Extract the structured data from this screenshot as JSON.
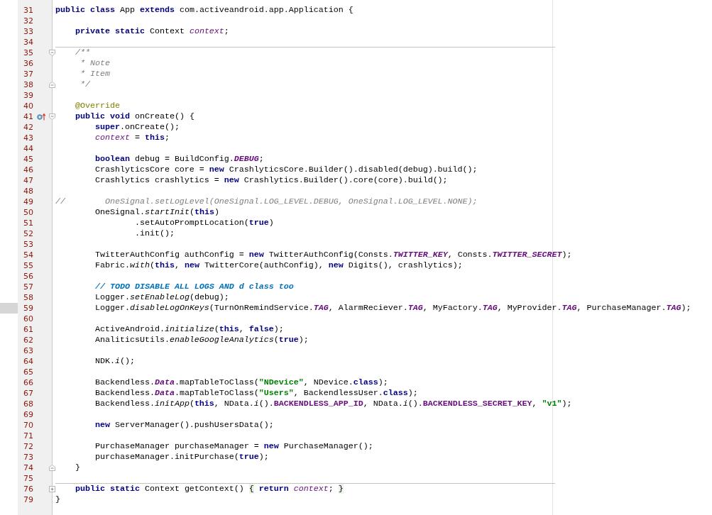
{
  "editor": {
    "lines": [
      {
        "number": "31",
        "current": false,
        "spans": [
          {
            "kind": "keyword",
            "text": "public class"
          },
          {
            "kind": "plain",
            "text": " App "
          },
          {
            "kind": "keyword",
            "text": "extends"
          },
          {
            "kind": "plain",
            "text": " com.activeandroid.app.Application {"
          }
        ]
      },
      {
        "number": "32",
        "current": false
      },
      {
        "number": "33",
        "current": false,
        "spans": [
          {
            "kind": "keyword",
            "text": "    private static"
          },
          {
            "kind": "plain",
            "text": " Context "
          },
          {
            "kind": "field",
            "text": "context"
          },
          {
            "kind": "plain",
            "text": ";"
          }
        ]
      },
      {
        "number": "34",
        "current": false
      },
      {
        "number": "35",
        "current": false,
        "separator": true,
        "fold": {
          "kind": "start"
        },
        "spans": [
          {
            "kind": "doc",
            "text": "    /**"
          }
        ]
      },
      {
        "number": "36",
        "current": false,
        "spans": [
          {
            "kind": "doc",
            "text": "     * Note"
          }
        ]
      },
      {
        "number": "37",
        "current": false,
        "spans": [
          {
            "kind": "doc",
            "text": "     * Item"
          }
        ]
      },
      {
        "number": "38",
        "current": false,
        "fold": {
          "kind": "end"
        },
        "spans": [
          {
            "kind": "doc",
            "text": "     */"
          }
        ]
      },
      {
        "number": "39",
        "current": false
      },
      {
        "number": "40",
        "current": false,
        "spans": [
          {
            "kind": "annotation",
            "text": "    @Override"
          }
        ]
      },
      {
        "number": "41",
        "current": false,
        "gutter_icon": {
          "kind": "override"
        },
        "fold": {
          "kind": "start"
        },
        "spans": [
          {
            "kind": "keyword",
            "text": "    public void"
          },
          {
            "kind": "plain",
            "text": " onCreate() {"
          }
        ]
      },
      {
        "number": "42",
        "current": false,
        "spans": [
          {
            "kind": "keyword",
            "text": "        super"
          },
          {
            "kind": "plain",
            "text": ".onCreate();"
          }
        ]
      },
      {
        "number": "43",
        "current": false,
        "spans": [
          {
            "kind": "field",
            "text": "        context"
          },
          {
            "kind": "plain",
            "text": " = "
          },
          {
            "kind": "keyword",
            "text": "this"
          },
          {
            "kind": "plain",
            "text": ";"
          }
        ]
      },
      {
        "number": "44",
        "current": false
      },
      {
        "number": "45",
        "current": false,
        "spans": [
          {
            "kind": "keyword",
            "text": "        boolean"
          },
          {
            "kind": "plain",
            "text": " debug = BuildConfig."
          },
          {
            "kind": "static-field",
            "text": "DEBUG"
          },
          {
            "kind": "plain",
            "text": ";"
          }
        ]
      },
      {
        "number": "46",
        "current": false,
        "spans": [
          {
            "kind": "plain",
            "text": "        CrashlyticsCore core = "
          },
          {
            "kind": "keyword",
            "text": "new"
          },
          {
            "kind": "plain",
            "text": " CrashlyticsCore.Builder().disabled(debug).build();"
          }
        ]
      },
      {
        "number": "47",
        "current": false,
        "spans": [
          {
            "kind": "plain",
            "text": "        Crashlytics crashlytics = "
          },
          {
            "kind": "keyword",
            "text": "new"
          },
          {
            "kind": "plain",
            "text": " Crashlytics.Builder().core(core).build();"
          }
        ]
      },
      {
        "number": "48",
        "current": false
      },
      {
        "number": "49",
        "current": false,
        "spans": [
          {
            "kind": "comment",
            "text": "//        OneSignal.setLogLevel(OneSignal.LOG_LEVEL.DEBUG, OneSignal.LOG_LEVEL.NONE);"
          }
        ]
      },
      {
        "number": "50",
        "current": false,
        "spans": [
          {
            "kind": "plain",
            "text": "        OneSignal."
          },
          {
            "kind": "static-method",
            "text": "startInit"
          },
          {
            "kind": "plain",
            "text": "("
          },
          {
            "kind": "keyword",
            "text": "this"
          },
          {
            "kind": "plain",
            "text": ")"
          }
        ]
      },
      {
        "number": "51",
        "current": false,
        "spans": [
          {
            "kind": "plain",
            "text": "                .setAutoPromptLocation("
          },
          {
            "kind": "keyword",
            "text": "true"
          },
          {
            "kind": "plain",
            "text": ")"
          }
        ]
      },
      {
        "number": "52",
        "current": false,
        "spans": [
          {
            "kind": "plain",
            "text": "                .init();"
          }
        ]
      },
      {
        "number": "53",
        "current": false
      },
      {
        "number": "54",
        "current": false,
        "spans": [
          {
            "kind": "plain",
            "text": "        TwitterAuthConfig authConfig = "
          },
          {
            "kind": "keyword",
            "text": "new"
          },
          {
            "kind": "plain",
            "text": " TwitterAuthConfig(Consts."
          },
          {
            "kind": "static-field",
            "text": "TWITTER_KEY"
          },
          {
            "kind": "plain",
            "text": ", Consts."
          },
          {
            "kind": "static-field",
            "text": "TWITTER_SECRET"
          },
          {
            "kind": "plain",
            "text": ");"
          }
        ]
      },
      {
        "number": "55",
        "current": false,
        "spans": [
          {
            "kind": "plain",
            "text": "        Fabric."
          },
          {
            "kind": "static-method",
            "text": "with"
          },
          {
            "kind": "plain",
            "text": "("
          },
          {
            "kind": "keyword",
            "text": "this"
          },
          {
            "kind": "plain",
            "text": ", "
          },
          {
            "kind": "keyword",
            "text": "new"
          },
          {
            "kind": "plain",
            "text": " TwitterCore(authConfig), "
          },
          {
            "kind": "keyword",
            "text": "new"
          },
          {
            "kind": "plain",
            "text": " Digits(), crashlytics);"
          }
        ]
      },
      {
        "number": "56",
        "current": false
      },
      {
        "number": "57",
        "current": false,
        "spans": [
          {
            "kind": "todo",
            "text": "        // TODO DISABLE ALL LOGS AND d class too"
          }
        ]
      },
      {
        "number": "58",
        "current": false,
        "spans": [
          {
            "kind": "plain",
            "text": "        Logger."
          },
          {
            "kind": "static-method",
            "text": "setEnableLog"
          },
          {
            "kind": "plain",
            "text": "(debug);"
          }
        ]
      },
      {
        "number": "59",
        "current": true,
        "spans": [
          {
            "kind": "plain",
            "text": "        Logger."
          },
          {
            "kind": "static-method",
            "text": "disableLogOnKeys"
          },
          {
            "kind": "plain",
            "text": "(TurnOnRemindService."
          },
          {
            "kind": "static-field",
            "text": "TAG"
          },
          {
            "kind": "plain",
            "text": ", AlarmReciever."
          },
          {
            "kind": "static-field",
            "text": "TAG"
          },
          {
            "kind": "plain",
            "text": ", MyFactory."
          },
          {
            "kind": "static-field",
            "text": "TAG"
          },
          {
            "kind": "plain",
            "text": ", MyProvider."
          },
          {
            "kind": "static-field",
            "text": "TAG"
          },
          {
            "kind": "plain",
            "text": ", PurchaseManager."
          },
          {
            "kind": "static-field",
            "text": "TAG"
          },
          {
            "kind": "plain",
            "text": ");"
          }
        ]
      },
      {
        "number": "60",
        "current": false
      },
      {
        "number": "61",
        "current": false,
        "spans": [
          {
            "kind": "plain",
            "text": "        ActiveAndroid."
          },
          {
            "kind": "static-method",
            "text": "initialize"
          },
          {
            "kind": "plain",
            "text": "("
          },
          {
            "kind": "keyword",
            "text": "this"
          },
          {
            "kind": "plain",
            "text": ", "
          },
          {
            "kind": "keyword",
            "text": "false"
          },
          {
            "kind": "plain",
            "text": ");"
          }
        ]
      },
      {
        "number": "62",
        "current": false,
        "spans": [
          {
            "kind": "plain",
            "text": "        AnaliticsUtils."
          },
          {
            "kind": "static-method",
            "text": "enableGoogleAnalytics"
          },
          {
            "kind": "plain",
            "text": "("
          },
          {
            "kind": "keyword",
            "text": "true"
          },
          {
            "kind": "plain",
            "text": ");"
          }
        ]
      },
      {
        "number": "63",
        "current": false
      },
      {
        "number": "64",
        "current": false,
        "spans": [
          {
            "kind": "plain",
            "text": "        NDK."
          },
          {
            "kind": "static-method",
            "text": "i"
          },
          {
            "kind": "plain",
            "text": "();"
          }
        ]
      },
      {
        "number": "65",
        "current": false
      },
      {
        "number": "66",
        "current": false,
        "spans": [
          {
            "kind": "plain",
            "text": "        Backendless."
          },
          {
            "kind": "static-field",
            "text": "Data"
          },
          {
            "kind": "plain",
            "text": ".mapTableToClass("
          },
          {
            "kind": "string",
            "text": "\"NDevice\""
          },
          {
            "kind": "plain",
            "text": ", NDevice."
          },
          {
            "kind": "keyword",
            "text": "class"
          },
          {
            "kind": "plain",
            "text": ");"
          }
        ]
      },
      {
        "number": "67",
        "current": false,
        "spans": [
          {
            "kind": "plain",
            "text": "        Backendless."
          },
          {
            "kind": "static-field",
            "text": "Data"
          },
          {
            "kind": "plain",
            "text": ".mapTableToClass("
          },
          {
            "kind": "string",
            "text": "\"Users\""
          },
          {
            "kind": "plain",
            "text": ", BackendlessUser."
          },
          {
            "kind": "keyword",
            "text": "class"
          },
          {
            "kind": "plain",
            "text": ");"
          }
        ]
      },
      {
        "number": "68",
        "current": false,
        "spans": [
          {
            "kind": "plain",
            "text": "        Backendless."
          },
          {
            "kind": "static-method",
            "text": "initApp"
          },
          {
            "kind": "plain",
            "text": "("
          },
          {
            "kind": "keyword",
            "text": "this"
          },
          {
            "kind": "plain",
            "text": ", NData."
          },
          {
            "kind": "static-method",
            "text": "i"
          },
          {
            "kind": "plain",
            "text": "()."
          },
          {
            "kind": "constant",
            "text": "BACKENDLESS_APP_ID"
          },
          {
            "kind": "plain",
            "text": ", NData."
          },
          {
            "kind": "static-method",
            "text": "i"
          },
          {
            "kind": "plain",
            "text": "()."
          },
          {
            "kind": "constant",
            "text": "BACKENDLESS_SECRET_KEY"
          },
          {
            "kind": "plain",
            "text": ", "
          },
          {
            "kind": "string",
            "text": "\"v1\""
          },
          {
            "kind": "plain",
            "text": ");"
          }
        ]
      },
      {
        "number": "69",
        "current": false
      },
      {
        "number": "70",
        "current": false,
        "spans": [
          {
            "kind": "keyword",
            "text": "        new"
          },
          {
            "kind": "plain",
            "text": " ServerManager().pushUsersData();"
          }
        ]
      },
      {
        "number": "71",
        "current": false
      },
      {
        "number": "72",
        "current": false,
        "spans": [
          {
            "kind": "plain",
            "text": "        PurchaseManager purchaseManager = "
          },
          {
            "kind": "keyword",
            "text": "new"
          },
          {
            "kind": "plain",
            "text": " PurchaseManager();"
          }
        ]
      },
      {
        "number": "73",
        "current": false,
        "spans": [
          {
            "kind": "plain",
            "text": "        purchaseManager.initPurchase("
          },
          {
            "kind": "keyword",
            "text": "true"
          },
          {
            "kind": "plain",
            "text": ");"
          }
        ]
      },
      {
        "number": "74",
        "current": false,
        "fold": {
          "kind": "end"
        },
        "spans": [
          {
            "kind": "plain",
            "text": "    }"
          }
        ]
      },
      {
        "number": "75",
        "current": false
      },
      {
        "number": "76",
        "current": false,
        "separator": true,
        "fold": {
          "kind": "collapsed"
        },
        "spans": [
          {
            "kind": "keyword",
            "text": "    public static"
          },
          {
            "kind": "plain",
            "text": " Context getContext() "
          },
          {
            "kind": "fold-brace",
            "text": "{"
          },
          {
            "kind": "keyword",
            "text": " return"
          },
          {
            "kind": "field",
            "text": " context"
          },
          {
            "kind": "plain",
            "text": "; "
          },
          {
            "kind": "fold-brace",
            "text": "}"
          }
        ]
      },
      {
        "number": "79",
        "current": false,
        "spans": [
          {
            "kind": "plain",
            "text": "}"
          }
        ]
      }
    ]
  }
}
